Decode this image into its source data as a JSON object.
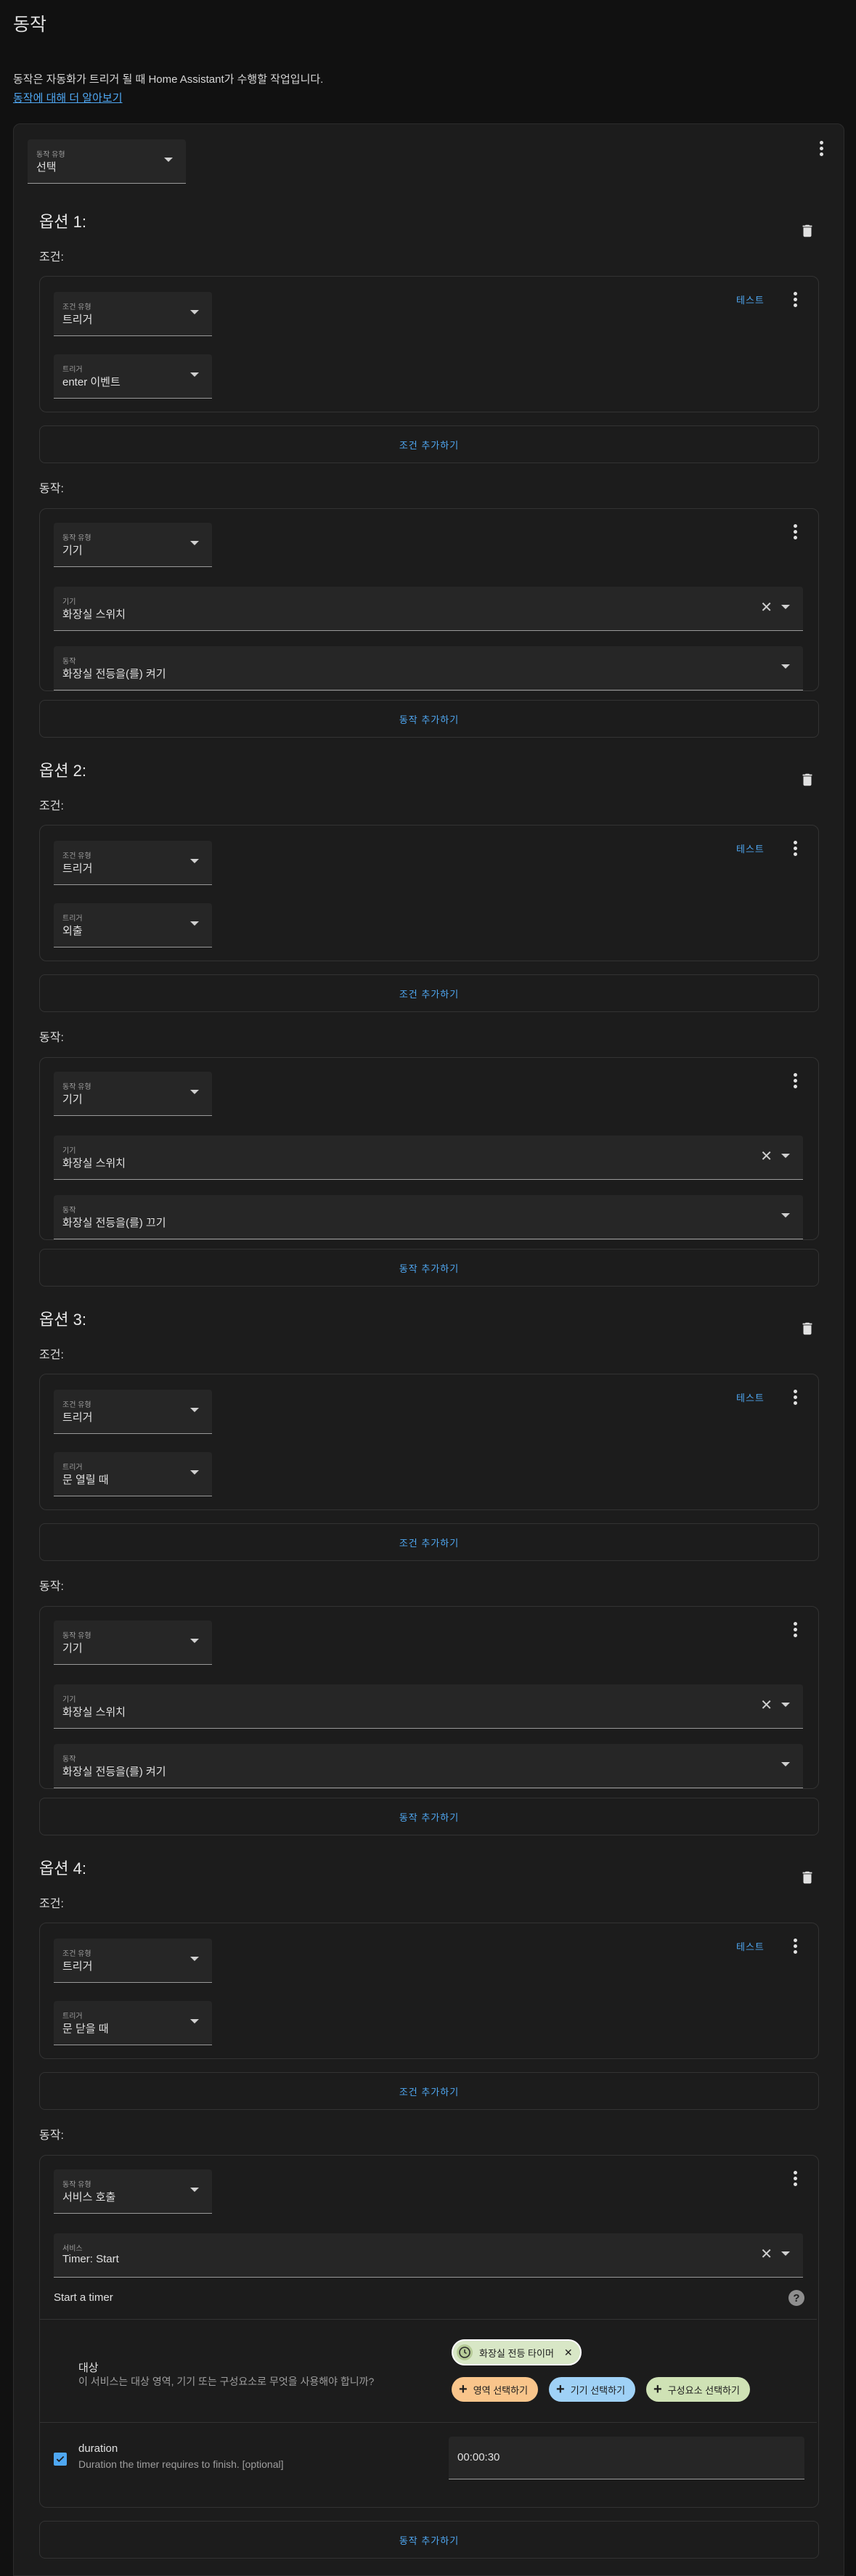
{
  "header": {
    "title": "동작",
    "description": "동작은 자동화가 트리거 될 때 Home Assistant가 수행할 작업입니다.",
    "learn_more": "동작에 대해 더 알아보기"
  },
  "choose": {
    "type_label": "동작 유형",
    "type_value": "선택"
  },
  "labels": {
    "conditions": "조건:",
    "actions": "동작:",
    "add_condition": "조건 추가하기",
    "add_action": "동작 추가하기",
    "test": "테스트",
    "condition_type": "조건 유형",
    "trigger": "트리거",
    "action_type": "동작 유형",
    "device": "기기",
    "action": "동작",
    "service": "서비스"
  },
  "options": [
    {
      "title": "옵션 1:",
      "condition_type": "트리거",
      "trigger": "enter 이벤트",
      "action_type": "기기",
      "device": "화장실 스위치",
      "action": "화장실 전등을(를) 켜기"
    },
    {
      "title": "옵션 2:",
      "condition_type": "트리거",
      "trigger": "외출",
      "action_type": "기기",
      "device": "화장실 스위치",
      "action": "화장실 전등을(를) 끄기"
    },
    {
      "title": "옵션 3:",
      "condition_type": "트리거",
      "trigger": "문 열릴 때",
      "action_type": "기기",
      "device": "화장실 스위치",
      "action": "화장실 전등을(를) 켜기"
    },
    {
      "title": "옵션 4:",
      "condition_type": "트리거",
      "trigger": "문 닫을 때",
      "action_type": "서비스 호출",
      "service": "Timer: Start"
    }
  ],
  "service_call": {
    "description": "Start a timer",
    "target_title": "대상",
    "target_desc": "이 서비스는 대상 영역, 기기 또는 구성요소로 무엇을 사용해야 합니까?",
    "target_entity": "화장실 전등 타이머",
    "chip_area": "영역 선택하기",
    "chip_device": "기기 선택하기",
    "chip_entity": "구성요소 선택하기",
    "duration_name": "duration",
    "duration_desc": "Duration the timer requires to finish. [optional]",
    "duration_value": "00:00:30",
    "duration_checked": true
  },
  "colors": {
    "accent": "#4fa8f3",
    "background": "#111111",
    "card": "#1c1c1c",
    "chip_area": "#f9c58b",
    "chip_device": "#9fd1f6",
    "chip_entity": "#cfe2b5",
    "entity_chip": "#d8e7c6"
  }
}
